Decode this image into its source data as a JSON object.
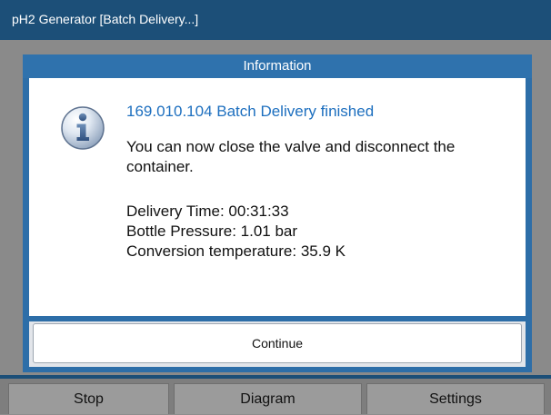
{
  "window": {
    "title": "pH2 Generator  [Batch Delivery...]"
  },
  "dialog": {
    "header": "Information",
    "icon": "info-icon",
    "heading": "169.010.104 Batch Delivery finished",
    "message_line1": "You can now close the valve and disconnect the",
    "message_line2": "container.",
    "delivery_time": "Delivery Time: 00:31:33",
    "bottle_pressure": "Bottle Pressure: 1.01 bar",
    "conversion_temperature": "Conversion temperature: 35.9 K",
    "continue_label": "Continue"
  },
  "bottom_bar": {
    "stop_label": "Stop",
    "diagram_label": "Diagram",
    "settings_label": "Settings"
  },
  "colors": {
    "title_bar": "#1c4f78",
    "dialog_frame": "#2d6ea8",
    "heading_text": "#1d6fbf",
    "background": "#8a8a8a"
  }
}
